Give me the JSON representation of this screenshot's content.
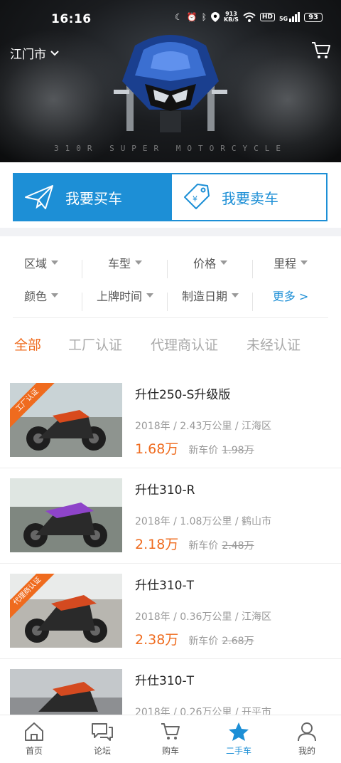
{
  "status": {
    "time": "16:16",
    "speed_value": "913",
    "speed_unit": "KB/S",
    "hd": "HD",
    "network": "5G",
    "battery": "93"
  },
  "header": {
    "city": "江门市",
    "hero_caption": "310R SUPER MOTORCYCLE"
  },
  "actions": {
    "buy": "我要买车",
    "sell": "我要卖车"
  },
  "filters": {
    "row1": [
      "区域",
      "车型",
      "价格",
      "里程"
    ],
    "row2": [
      "颜色",
      "上牌时间",
      "制造日期"
    ],
    "more": "更多 >"
  },
  "tabs": [
    "全部",
    "工厂认证",
    "代理商认证",
    "未经认证"
  ],
  "listings": [
    {
      "title": "升仕250-S升级版",
      "meta": "2018年 / 2.43万公里 / 江海区",
      "price": "1.68万",
      "new_label": "新车价",
      "old_price": "1.98万",
      "badge": "工厂认证"
    },
    {
      "title": "升仕310-R",
      "meta": "2018年 / 1.08万公里 / 鹤山市",
      "price": "2.18万",
      "new_label": "新车价",
      "old_price": "2.48万",
      "badge": ""
    },
    {
      "title": "升仕310-T",
      "meta": "2018年 / 0.36万公里 / 江海区",
      "price": "2.38万",
      "new_label": "新车价",
      "old_price": "2.68万",
      "badge": "代理商认证"
    },
    {
      "title": "升仕310-T",
      "meta": "2018年 / 0.26万公里 / 开平市",
      "price": "",
      "new_label": "",
      "old_price": "",
      "badge": ""
    }
  ],
  "nav": [
    "首页",
    "论坛",
    "购车",
    "二手车",
    "我的"
  ],
  "colors": {
    "accent": "#1d8fd6",
    "price": "#ef6b1e"
  }
}
